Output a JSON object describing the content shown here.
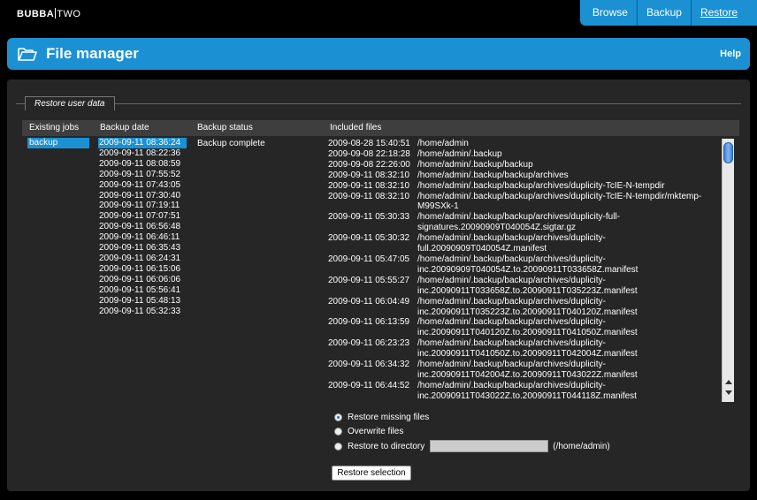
{
  "brand": {
    "part1": "BUBBA",
    "part2": "TWO"
  },
  "nav": {
    "browse": "Browse",
    "backup": "Backup",
    "restore": "Restore"
  },
  "header": {
    "title": "File manager",
    "help": "Help",
    "icon": "folder-open-icon"
  },
  "panel": {
    "legend": "Restore user data"
  },
  "table": {
    "headers": {
      "jobs": "Existing jobs",
      "date": "Backup date",
      "status": "Backup status",
      "files": "Included files"
    },
    "jobs": [
      "backup"
    ],
    "dates": [
      "2009-09-11 08:36:24",
      "2009-09-11 08:22:36",
      "2009-09-11 08:08:59",
      "2009-09-11 07:55:52",
      "2009-09-11 07:43:05",
      "2009-09-11 07:30:40",
      "2009-09-11 07:19:11",
      "2009-09-11 07:07:51",
      "2009-09-11 06:56:48",
      "2009-09-11 06:46:11",
      "2009-09-11 06:35:43",
      "2009-09-11 06:24:31",
      "2009-09-11 06:15:06",
      "2009-09-11 06:06:06",
      "2009-09-11 05:56:41",
      "2009-09-11 05:48:13",
      "2009-09-11 05:32:33"
    ],
    "status": "Backup complete",
    "files": [
      {
        "d": "2009-08-28 15:40:51",
        "p": "/home/admin"
      },
      {
        "d": "2009-09-08 22:18:28",
        "p": "/home/admin/.backup"
      },
      {
        "d": "2009-09-08 22:26:00",
        "p": "/home/admin/.backup/backup"
      },
      {
        "d": "2009-09-11 08:32:10",
        "p": "/home/admin/.backup/backup/archives"
      },
      {
        "d": "2009-09-11 08:32:10",
        "p": "/home/admin/.backup/backup/archives/duplicity-TcIE-N-tempdir"
      },
      {
        "d": "2009-09-11 08:32:10",
        "p": "/home/admin/.backup/backup/archives/duplicity-TcIE-N-tempdir/mktemp-"
      },
      {
        "d": "",
        "p": "M99SXk-1"
      },
      {
        "d": "2009-09-11 05:30:33",
        "p": "/home/admin/.backup/backup/archives/duplicity-full-"
      },
      {
        "d": "",
        "p": "signatures.20090909T040054Z.sigtar.gz"
      },
      {
        "d": "2009-09-11 05:30:32",
        "p": "/home/admin/.backup/backup/archives/duplicity-"
      },
      {
        "d": "",
        "p": "full.20090909T040054Z.manifest"
      },
      {
        "d": "2009-09-11 05:47:05",
        "p": "/home/admin/.backup/backup/archives/duplicity-"
      },
      {
        "d": "",
        "p": "inc.20090909T040054Z.to.20090911T033658Z.manifest"
      },
      {
        "d": "2009-09-11 05:55:27",
        "p": "/home/admin/.backup/backup/archives/duplicity-"
      },
      {
        "d": "",
        "p": "inc.20090911T033658Z.to.20090911T035223Z.manifest"
      },
      {
        "d": "2009-09-11 06:04:49",
        "p": "/home/admin/.backup/backup/archives/duplicity-"
      },
      {
        "d": "",
        "p": "inc.20090911T035223Z.to.20090911T040120Z.manifest"
      },
      {
        "d": "2009-09-11 06:13:59",
        "p": "/home/admin/.backup/backup/archives/duplicity-"
      },
      {
        "d": "",
        "p": "inc.20090911T040120Z.to.20090911T041050Z.manifest"
      },
      {
        "d": "2009-09-11 06:23:23",
        "p": "/home/admin/.backup/backup/archives/duplicity-"
      },
      {
        "d": "",
        "p": "inc.20090911T041050Z.to.20090911T042004Z.manifest"
      },
      {
        "d": "2009-09-11 06:34:32",
        "p": "/home/admin/.backup/backup/archives/duplicity-"
      },
      {
        "d": "",
        "p": "inc.20090911T042004Z.to.20090911T043022Z.manifest"
      },
      {
        "d": "2009-09-11 06:44:52",
        "p": "/home/admin/.backup/backup/archives/duplicity-"
      },
      {
        "d": "",
        "p": "inc.20090911T043022Z.to.20090911T044118Z.manifest"
      }
    ]
  },
  "options": {
    "missing": "Restore missing files",
    "overwrite": "Overwrite files",
    "todir": "Restore to directory",
    "todir_hint": "(/home/admin)",
    "selected": "missing"
  },
  "button": {
    "restore": "Restore selection"
  }
}
